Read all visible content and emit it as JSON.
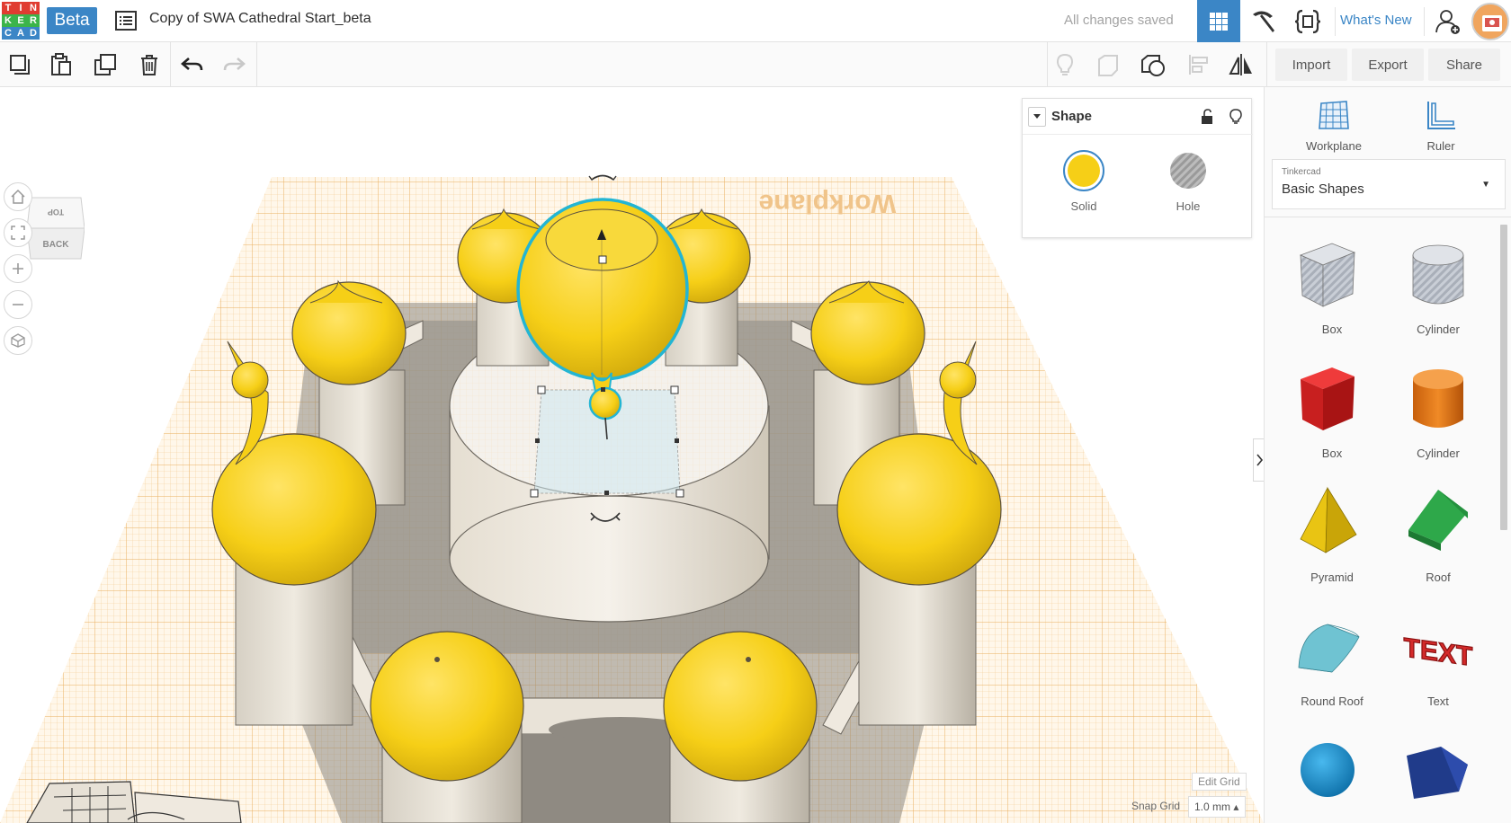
{
  "header": {
    "logo_letters": [
      "T",
      "I",
      "N",
      "K",
      "E",
      "R",
      "C",
      "A",
      "D"
    ],
    "logo_colors": [
      "#e03c31",
      "#e03c31",
      "#e03c31",
      "#3bb44a",
      "#3bb44a",
      "#3bb44a",
      "#3b86c6",
      "#3b86c6",
      "#3b86c6"
    ],
    "beta_label": "Beta",
    "document_title": "Copy of SWA Cathedral Start_beta",
    "save_status": "All changes saved",
    "whats_new": "What's New"
  },
  "toolbar": {
    "import_label": "Import",
    "export_label": "Export",
    "share_label": "Share"
  },
  "viewcube": {
    "top_face": "TOP",
    "front_face": "BACK"
  },
  "canvas": {
    "workplane_watermark": "Workplane",
    "edit_grid": "Edit Grid",
    "snap_grid_label": "Snap Grid",
    "snap_grid_value": "1.0 mm"
  },
  "inspector": {
    "title": "Shape",
    "solid_label": "Solid",
    "hole_label": "Hole",
    "solid_color": "#f6cf17"
  },
  "right_panel": {
    "workplane_label": "Workplane",
    "ruler_label": "Ruler",
    "library_source": "Tinkercad",
    "library_name": "Basic Shapes",
    "shapes": [
      {
        "label": "Box",
        "icon": "box-hole-icon"
      },
      {
        "label": "Cylinder",
        "icon": "cylinder-hole-icon"
      },
      {
        "label": "Box",
        "icon": "box-red-icon"
      },
      {
        "label": "Cylinder",
        "icon": "cylinder-orange-icon"
      },
      {
        "label": "Pyramid",
        "icon": "pyramid-icon"
      },
      {
        "label": "Roof",
        "icon": "roof-icon"
      },
      {
        "label": "Round Roof",
        "icon": "round-roof-icon"
      },
      {
        "label": "Text",
        "icon": "text-shape-icon"
      },
      {
        "label": "",
        "icon": "sphere-icon"
      },
      {
        "label": "",
        "icon": "wedge-icon"
      }
    ]
  },
  "colors": {
    "accent": "#3b86c6",
    "dome": "#f6cf17",
    "grid_line": "#f0c27a",
    "selection": "#23b5d3"
  }
}
